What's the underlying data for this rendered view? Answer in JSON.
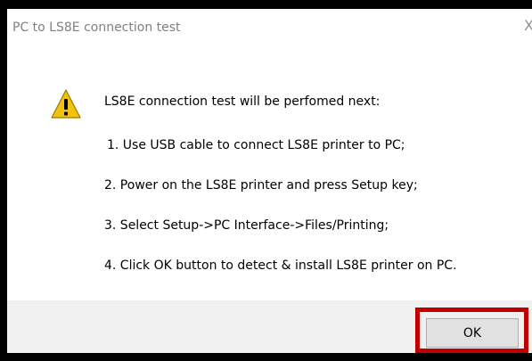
{
  "window": {
    "title": "PC to LS8E connection test",
    "close_glyph": "X"
  },
  "message": {
    "icon": "warning-icon",
    "heading": "LS8E connection test will be perfomed next:",
    "steps": [
      "1. Use USB cable to connect LS8E printer to PC;",
      "2. Power on the LS8E printer and press Setup key;",
      "3. Select Setup->PC Interface->Files/Printing;",
      "4. Click OK button to detect & install LS8E printer on PC."
    ]
  },
  "buttons": {
    "ok_label": "OK"
  },
  "colors": {
    "highlight": "#c00000",
    "footer": "#f0f0f0",
    "warning_fill": "#f2c20f"
  }
}
